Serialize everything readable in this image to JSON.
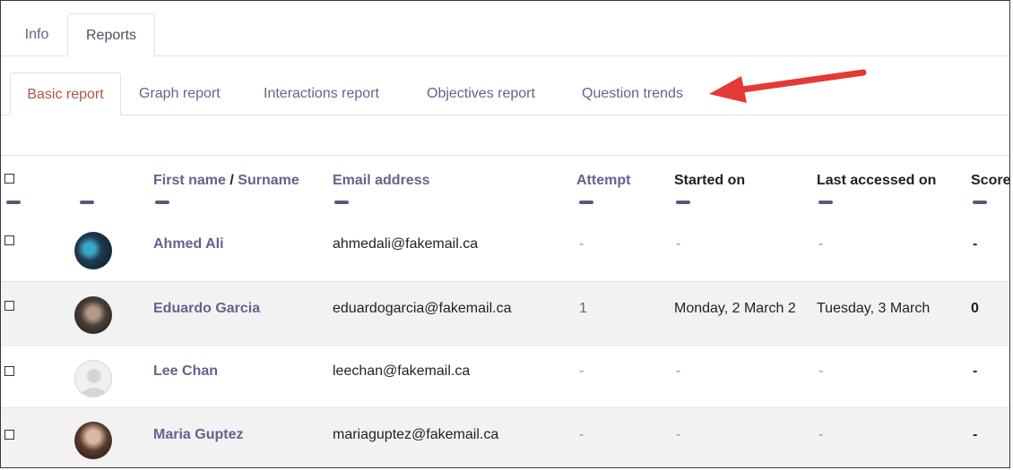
{
  "top_tabs": [
    {
      "label": "Info"
    },
    {
      "label": "Reports",
      "active": true
    }
  ],
  "report_tabs": [
    {
      "label": "Basic report",
      "active": true
    },
    {
      "label": "Graph report"
    },
    {
      "label": "Interactions report"
    },
    {
      "label": "Objectives report"
    },
    {
      "label": "Question trends"
    }
  ],
  "table": {
    "headers": {
      "first_name": "First name",
      "separator": "/",
      "surname": "Surname",
      "email": "Email address",
      "attempt": "Attempt",
      "started_on": "Started on",
      "last_accessed_on": "Last accessed on",
      "score": "Score"
    },
    "rows": [
      {
        "name": "Ahmed Ali",
        "email": "ahmedali@fakemail.ca",
        "attempt": "-",
        "started_on": "-",
        "last_accessed": "-",
        "score": "-"
      },
      {
        "name": "Eduardo Garcia",
        "email": "eduardogarcia@fakemail.ca",
        "attempt": "1",
        "started_on": "Monday, 2 March 2",
        "last_accessed": "Tuesday, 3 March",
        "score": "0"
      },
      {
        "name": "Lee Chan",
        "email": "leechan@fakemail.ca",
        "attempt": "-",
        "started_on": "-",
        "last_accessed": "-",
        "score": "-"
      },
      {
        "name": "Maria Guptez",
        "email": "mariaguptez@fakemail.ca",
        "attempt": "-",
        "started_on": "-",
        "last_accessed": "-",
        "score": "-"
      }
    ]
  },
  "colors": {
    "link": "#6a5f8c",
    "active_tab": "#b05548",
    "arrow": "#e53935",
    "row_shade": "#f2f2f2"
  }
}
